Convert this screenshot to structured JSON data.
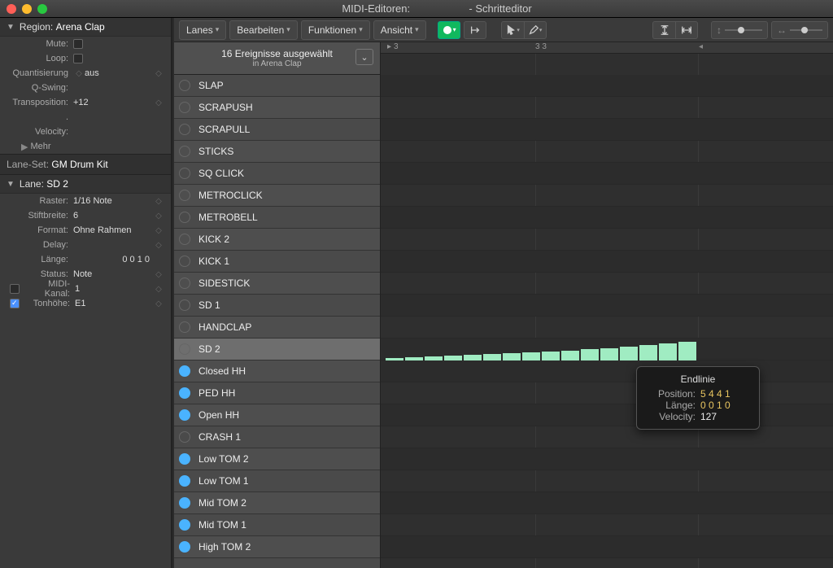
{
  "titlebar": {
    "left": "MIDI-Editoren:",
    "right": "- Schritteditor"
  },
  "toolbar": {
    "menus": [
      "Lanes",
      "Bearbeiten",
      "Funktionen",
      "Ansicht"
    ]
  },
  "region": {
    "header_label": "Region:",
    "header_value": "Arena Clap",
    "mute": "Mute:",
    "loop": "Loop:",
    "quant_label": "Quantisierung",
    "quant_value": "aus",
    "qswing": "Q-Swing:",
    "transposition_label": "Transposition:",
    "transposition_value": "+12",
    "velocity": "Velocity:",
    "more": "Mehr"
  },
  "laneset": {
    "label": "Lane-Set:",
    "value": "GM Drum Kit"
  },
  "lane_panel": {
    "header_label": "Lane:",
    "header_value": "SD 2",
    "raster_label": "Raster:",
    "raster_value": "1/16 Note",
    "stift_label": "Stiftbreite:",
    "stift_value": "6",
    "format_label": "Format:",
    "format_value": "Ohne Rahmen",
    "delay_label": "Delay:",
    "laenge_label": "Länge:",
    "laenge_value": "0 0 1   0",
    "status_label": "Status:",
    "status_value": "Note",
    "midi_label": "MIDI-Kanal:",
    "midi_value": "1",
    "tonhoehe_label": "Tonhöhe:",
    "tonhoehe_value": "E1"
  },
  "eventhdr": {
    "main": "16 Ereignisse ausgewählt",
    "sub": "in Arena Clap"
  },
  "ruler": {
    "a": "3",
    "b": "3 3"
  },
  "lanes": [
    {
      "name": "SLAP",
      "on": false
    },
    {
      "name": "SCRAPUSH",
      "on": false
    },
    {
      "name": "SCRAPULL",
      "on": false
    },
    {
      "name": "STICKS",
      "on": false
    },
    {
      "name": "SQ CLICK",
      "on": false
    },
    {
      "name": "METROCLICK",
      "on": false
    },
    {
      "name": "METROBELL",
      "on": false
    },
    {
      "name": "KICK 2",
      "on": false
    },
    {
      "name": "KICK 1",
      "on": false
    },
    {
      "name": "SIDESTICK",
      "on": false
    },
    {
      "name": "SD 1",
      "on": false
    },
    {
      "name": "HANDCLAP",
      "on": false
    },
    {
      "name": "SD 2",
      "on": false,
      "selected": true
    },
    {
      "name": "Closed HH",
      "on": true
    },
    {
      "name": "PED HH",
      "on": true
    },
    {
      "name": "Open HH",
      "on": true
    },
    {
      "name": "CRASH 1",
      "on": false
    },
    {
      "name": "Low TOM 2",
      "on": true
    },
    {
      "name": "Low TOM 1",
      "on": true
    },
    {
      "name": "Mid TOM 2",
      "on": true
    },
    {
      "name": "Mid TOM 1",
      "on": true
    },
    {
      "name": "High TOM 2",
      "on": true
    }
  ],
  "sd2_steps": [
    3,
    4,
    5,
    6,
    7,
    8,
    9,
    10,
    11,
    12,
    14,
    15,
    17,
    19,
    21,
    23
  ],
  "tooltip": {
    "title": "Endlinie",
    "pos_label": "Position:",
    "pos_value": "5 4 4 1",
    "len_label": "Länge:",
    "len_value": "0 0 1 0",
    "vel_label": "Velocity:",
    "vel_value": "127"
  }
}
